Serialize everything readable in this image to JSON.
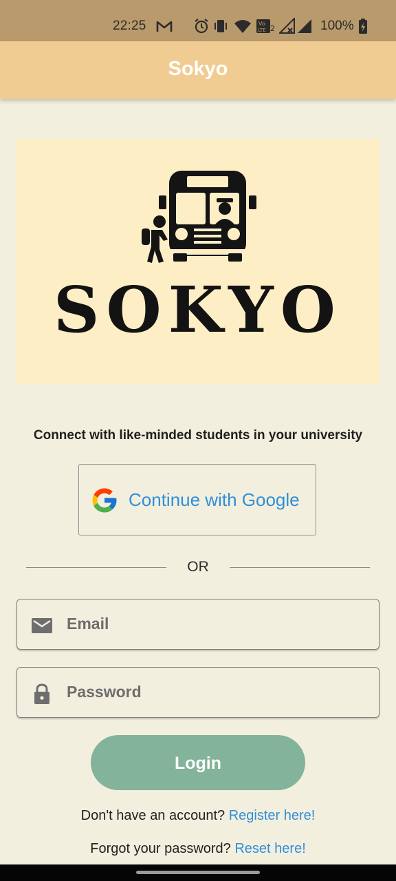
{
  "status_bar": {
    "time": "22:25",
    "battery": "100%",
    "icons": [
      "gmail-icon",
      "alarm-icon",
      "vibrate-icon",
      "wifi-icon",
      "volte-icon",
      "signal-icon",
      "battery-icon"
    ]
  },
  "app_bar": {
    "title": "Sokyo"
  },
  "logo": {
    "wordmark": "SOKYO",
    "background_color": "#feeec6"
  },
  "tagline": "Connect with like-minded students in your university",
  "google_button": {
    "label": "Continue with Google",
    "icon": "google-icon"
  },
  "divider": {
    "label": "OR"
  },
  "email_field": {
    "placeholder": "Email",
    "value": "",
    "icon": "mail-icon"
  },
  "password_field": {
    "placeholder": "Password",
    "value": "",
    "icon": "lock-icon"
  },
  "login_button": {
    "label": "Login",
    "color": "#83b39a"
  },
  "register": {
    "prompt": "Don't have an account?",
    "link": "Register here!"
  },
  "reset": {
    "prompt": "Forgot your password?",
    "link": "Reset here!"
  },
  "colors": {
    "app_bar": "#f1cc92",
    "status_bar": "#b89a6c",
    "background": "#f3efdf",
    "link": "#2f8fd8"
  }
}
